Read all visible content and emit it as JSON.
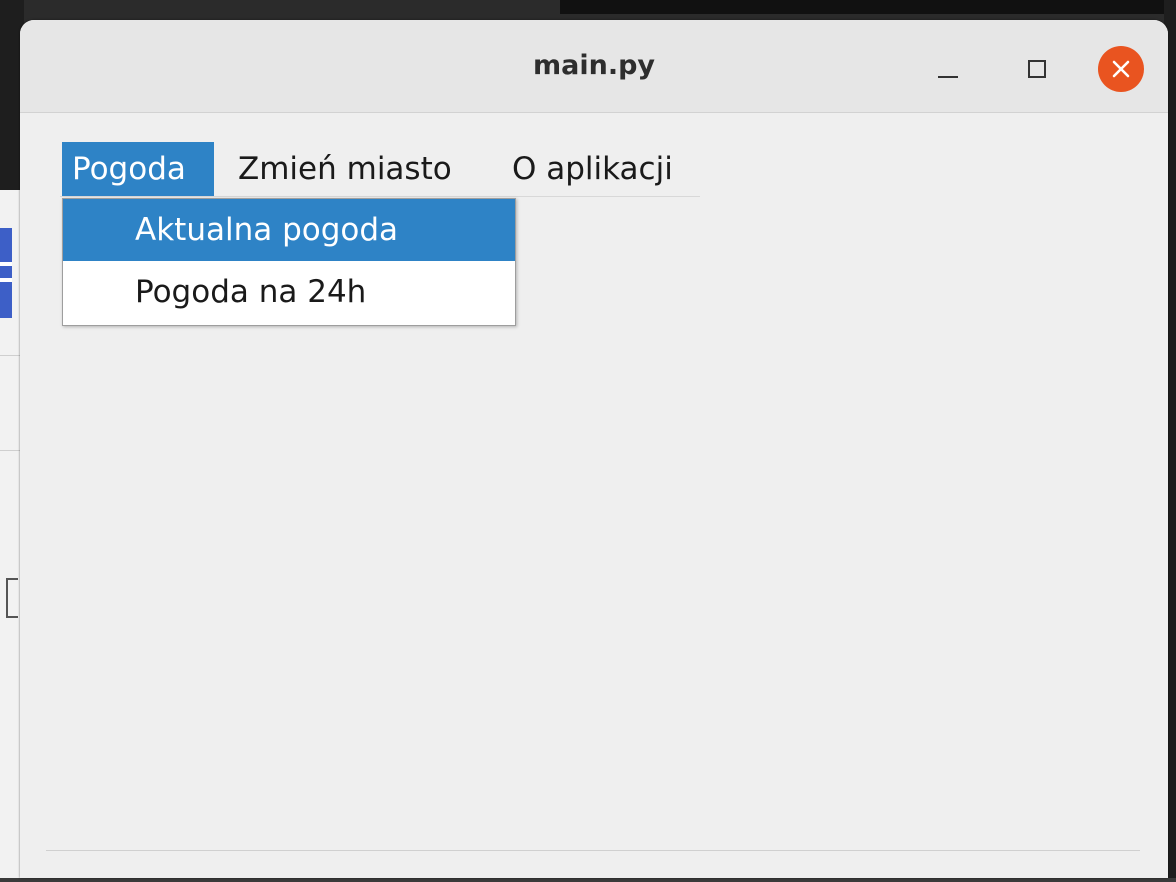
{
  "window": {
    "title": "main.py",
    "controls": {
      "minimize_icon": "minimize-icon",
      "maximize_icon": "maximize-icon",
      "close_icon": "close-icon"
    }
  },
  "menubar": {
    "items": [
      {
        "label": "Pogoda",
        "active": true
      },
      {
        "label": "Zmień miasto",
        "active": false
      },
      {
        "label": "O aplikacji",
        "active": false
      }
    ]
  },
  "dropdown": {
    "items": [
      {
        "label": "Aktualna pogoda",
        "highlighted": true
      },
      {
        "label": "Pogoda na 24h",
        "highlighted": false
      }
    ]
  },
  "colors": {
    "accent": "#2e83c6",
    "close_button": "#e95420",
    "titlebar": "#e6e6e6",
    "window_bg": "#efefef"
  }
}
